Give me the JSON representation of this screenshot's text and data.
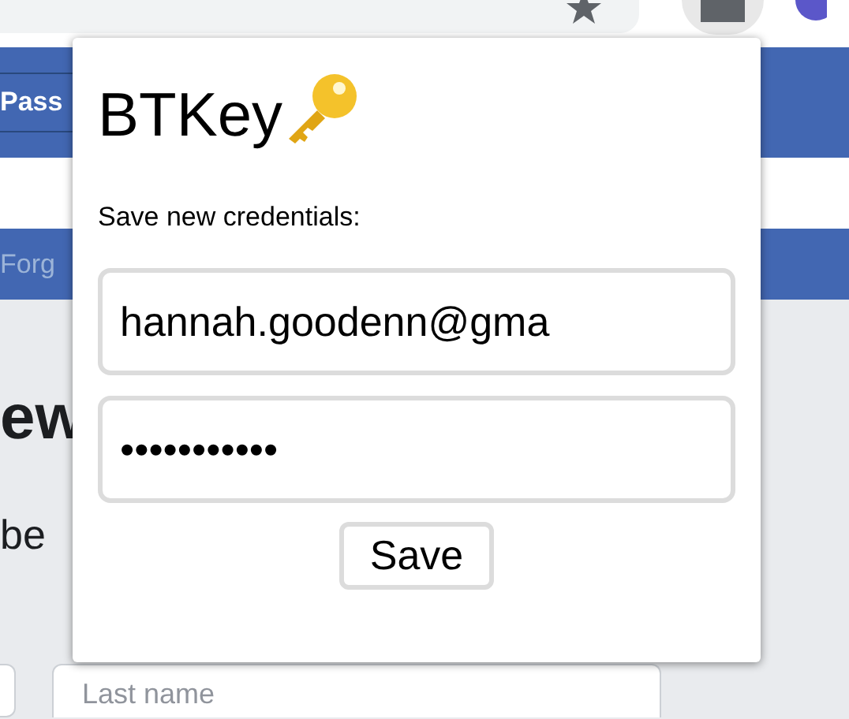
{
  "page": {
    "login_button": "Pass",
    "forgot_link": "Forg",
    "heading": "ew",
    "subheading": "be",
    "last_name_field": {
      "placeholder": "Last name"
    }
  },
  "popup": {
    "title": "BTKey",
    "prompt": "Save new credentials:",
    "username": "hannah.goodenn@gma",
    "password": "•••••••••••",
    "save_button": "Save"
  }
}
